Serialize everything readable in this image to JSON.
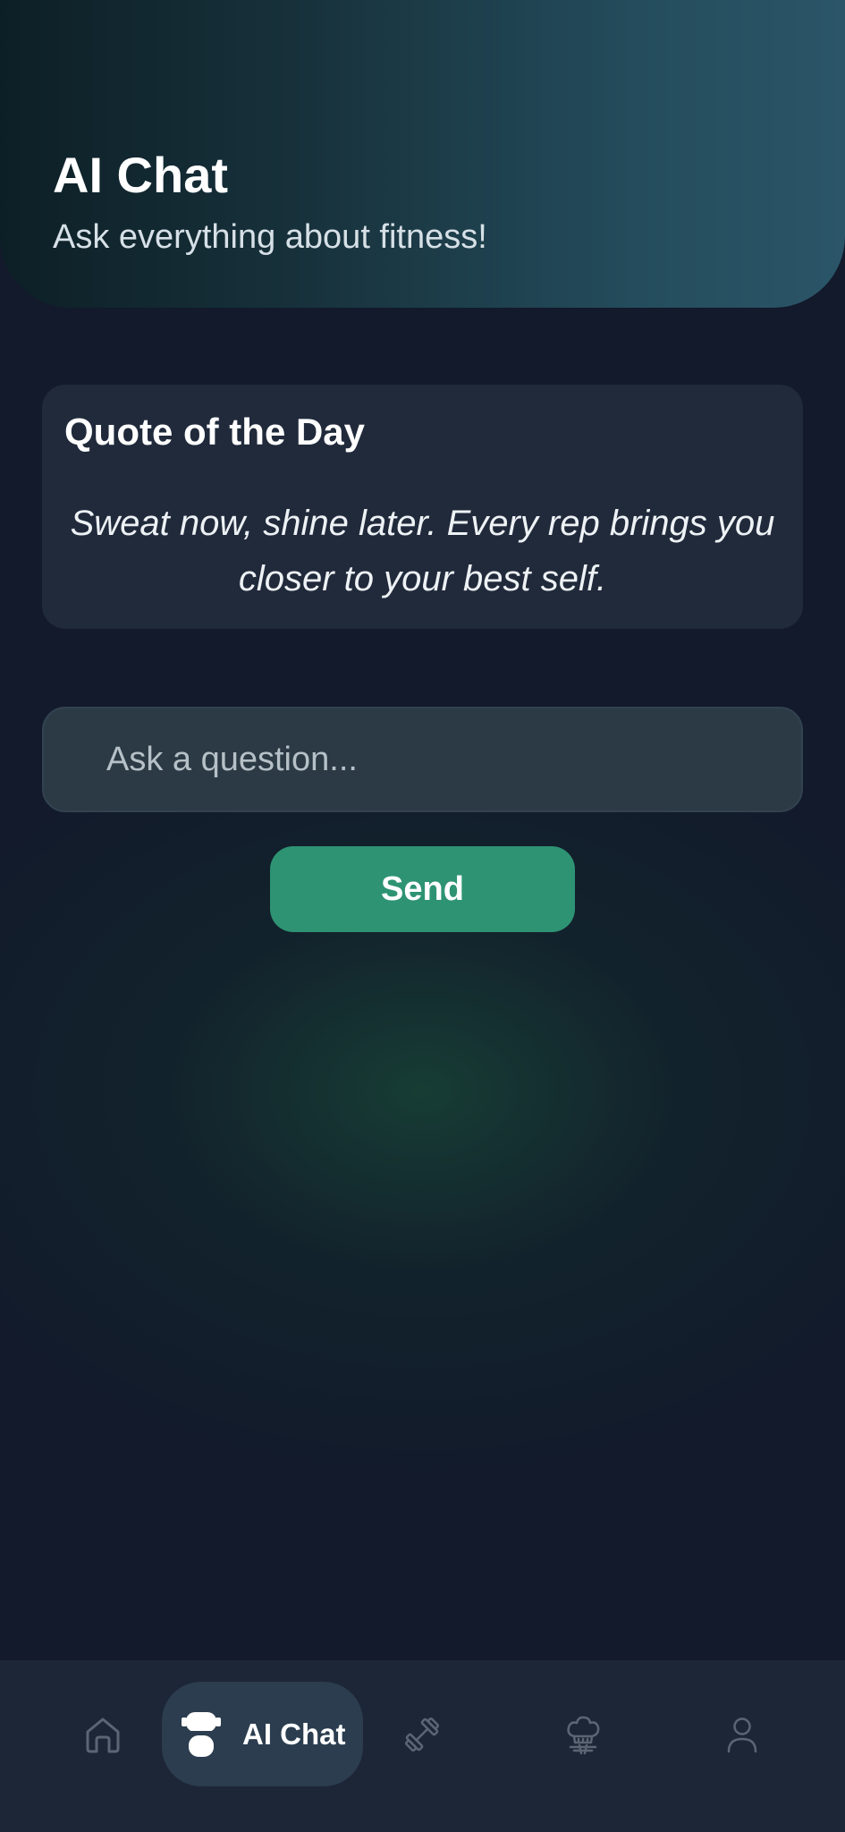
{
  "header": {
    "title": "AI Chat",
    "subtitle": "Ask everything about fitness!"
  },
  "quote": {
    "title": "Quote of the Day",
    "text": "Sweat now, shine later. Every rep brings you closer to your best self."
  },
  "chat_input": {
    "value": "",
    "placeholder": "Ask a question..."
  },
  "send_button": {
    "label": "Send"
  },
  "bottom_nav": {
    "items": [
      {
        "icon": "home-icon",
        "label": "",
        "active": false
      },
      {
        "icon": "robot-chat-icon",
        "label": "AI Chat",
        "active": true
      },
      {
        "icon": "dumbbell-icon",
        "label": "",
        "active": false
      },
      {
        "icon": "chef-hat-icon",
        "label": "",
        "active": false
      },
      {
        "icon": "profile-icon",
        "label": "",
        "active": false
      }
    ]
  },
  "colors": {
    "background": "#121a2b",
    "card": "#202a3b",
    "input": "#2c3a45",
    "accent": "#2e9373",
    "nav_background": "#1d2637",
    "nav_active": "#2b3d4f",
    "nav_icon_inactive": "#5b6573"
  }
}
